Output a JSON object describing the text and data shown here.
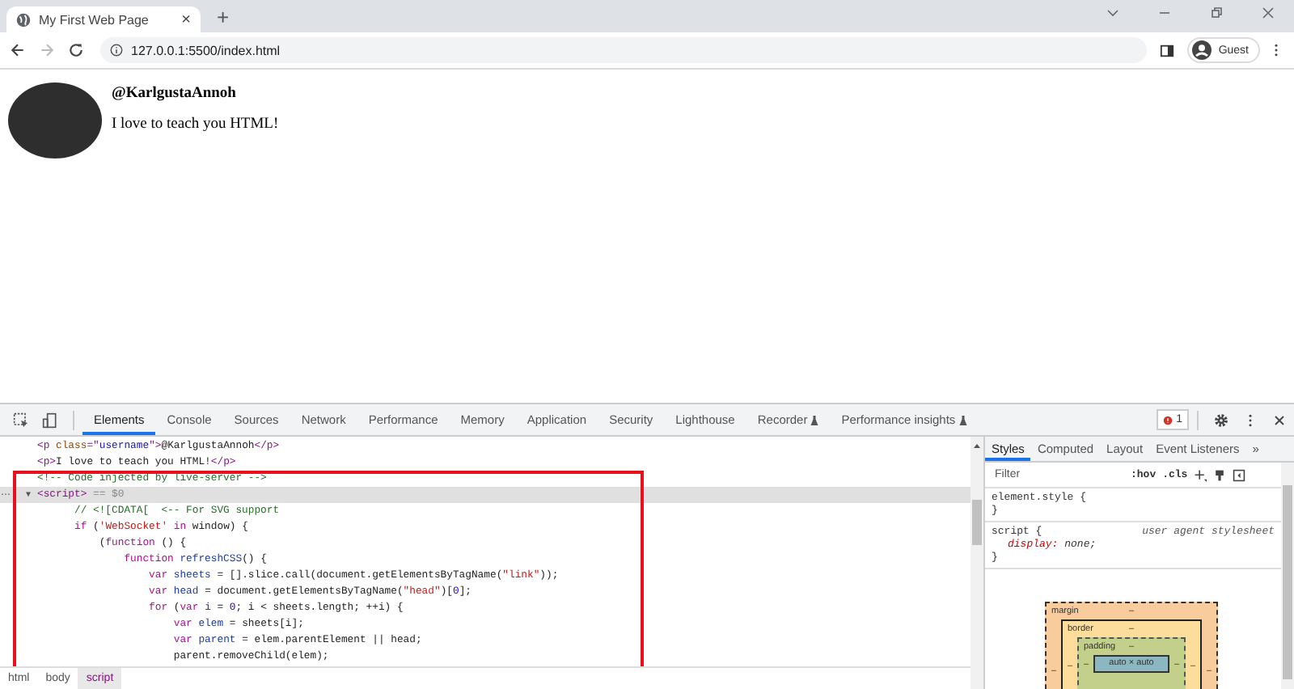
{
  "browser": {
    "tab": {
      "title": "My First Web Page",
      "close": "×"
    },
    "new_tab": "+",
    "address": "127.0.0.1:5500/index.html",
    "profile": "Guest"
  },
  "page": {
    "username": "@KarlgustaAnnoh",
    "text": "I love to teach you HTML!"
  },
  "devtools": {
    "tabs": [
      {
        "label": "Elements",
        "selected": true,
        "experimental": false
      },
      {
        "label": "Console",
        "selected": false,
        "experimental": false
      },
      {
        "label": "Sources",
        "selected": false,
        "experimental": false
      },
      {
        "label": "Network",
        "selected": false,
        "experimental": false
      },
      {
        "label": "Performance",
        "selected": false,
        "experimental": false
      },
      {
        "label": "Memory",
        "selected": false,
        "experimental": false
      },
      {
        "label": "Application",
        "selected": false,
        "experimental": false
      },
      {
        "label": "Security",
        "selected": false,
        "experimental": false
      },
      {
        "label": "Lighthouse",
        "selected": false,
        "experimental": false
      },
      {
        "label": "Recorder",
        "selected": false,
        "experimental": true
      },
      {
        "label": "Performance insights",
        "selected": false,
        "experimental": true
      }
    ],
    "error_count": "1",
    "code": [
      {
        "selected": false,
        "tokens": [
          {
            "text": "<p ",
            "kind": "tag"
          },
          {
            "text": "class",
            "kind": "attr"
          },
          {
            "text": "=\"",
            "kind": "tag"
          },
          {
            "text": "username",
            "kind": "value"
          },
          {
            "text": "\">",
            "kind": "tag"
          },
          {
            "text": "@KarlgustaAnnoh",
            "kind": "plain"
          },
          {
            "text": "</p>",
            "kind": "tag"
          }
        ]
      },
      {
        "selected": false,
        "tokens": [
          {
            "text": "<p>",
            "kind": "tag"
          },
          {
            "text": "I love to teach you HTML!",
            "kind": "plain"
          },
          {
            "text": "</p>",
            "kind": "tag"
          }
        ]
      },
      {
        "selected": false,
        "tokens": [
          {
            "text": "<!-- Code injected by live-server -->",
            "kind": "comment"
          }
        ]
      },
      {
        "selected": true,
        "gutter": "···",
        "toggle": "▼",
        "tokens": [
          {
            "text": "<script>",
            "kind": "tag"
          },
          {
            "text": " == $0",
            "kind": "dim"
          }
        ]
      },
      {
        "selected": false,
        "tokens": [
          {
            "text": "      // <![CDATA[  <-- For SVG support",
            "kind": "comment"
          }
        ]
      },
      {
        "selected": false,
        "tokens": [
          {
            "text": "      if",
            "kind": "keyword"
          },
          {
            "text": " (",
            "kind": "plain"
          },
          {
            "text": "'WebSocket'",
            "kind": "string"
          },
          {
            "text": " in ",
            "kind": "keyword"
          },
          {
            "text": "window) {",
            "kind": "plain"
          }
        ]
      },
      {
        "selected": false,
        "tokens": [
          {
            "text": "          (",
            "kind": "plain"
          },
          {
            "text": "function",
            "kind": "keyword"
          },
          {
            "text": " () {",
            "kind": "plain"
          }
        ]
      },
      {
        "selected": false,
        "tokens": [
          {
            "text": "              function",
            "kind": "keyword"
          },
          {
            "text": " refreshCSS",
            "kind": "name"
          },
          {
            "text": "() {",
            "kind": "plain"
          }
        ]
      },
      {
        "selected": false,
        "tokens": [
          {
            "text": "                  var",
            "kind": "keyword"
          },
          {
            "text": " sheets",
            "kind": "name"
          },
          {
            "text": " = [].slice.call(document.getElementsByTagName(",
            "kind": "plain"
          },
          {
            "text": "\"link\"",
            "kind": "string"
          },
          {
            "text": "));",
            "kind": "plain"
          }
        ]
      },
      {
        "selected": false,
        "tokens": [
          {
            "text": "                  var",
            "kind": "keyword"
          },
          {
            "text": " head",
            "kind": "name"
          },
          {
            "text": " = document.getElementsByTagName(",
            "kind": "plain"
          },
          {
            "text": "\"head\"",
            "kind": "string"
          },
          {
            "text": ")[",
            "kind": "plain"
          },
          {
            "text": "0",
            "kind": "number"
          },
          {
            "text": "];",
            "kind": "plain"
          }
        ]
      },
      {
        "selected": false,
        "tokens": [
          {
            "text": "                  for",
            "kind": "keyword"
          },
          {
            "text": " (",
            "kind": "plain"
          },
          {
            "text": "var",
            "kind": "keyword"
          },
          {
            "text": " i",
            "kind": "name"
          },
          {
            "text": " = ",
            "kind": "plain"
          },
          {
            "text": "0",
            "kind": "number"
          },
          {
            "text": "; i < sheets.length; ++i) {",
            "kind": "plain"
          }
        ]
      },
      {
        "selected": false,
        "tokens": [
          {
            "text": "                      var",
            "kind": "keyword"
          },
          {
            "text": " elem",
            "kind": "name"
          },
          {
            "text": " = sheets[i];",
            "kind": "plain"
          }
        ]
      },
      {
        "selected": false,
        "tokens": [
          {
            "text": "                      var",
            "kind": "keyword"
          },
          {
            "text": " parent",
            "kind": "name"
          },
          {
            "text": " = elem.parentElement || head;",
            "kind": "plain"
          }
        ]
      },
      {
        "selected": false,
        "tokens": [
          {
            "text": "                      parent.removeChild(elem);",
            "kind": "plain"
          }
        ]
      }
    ],
    "breadcrumbs": [
      {
        "label": "html",
        "selected": false
      },
      {
        "label": "body",
        "selected": false
      },
      {
        "label": "script",
        "selected": true
      }
    ],
    "side_tabs": [
      {
        "label": "Styles",
        "selected": true
      },
      {
        "label": "Computed",
        "selected": false
      },
      {
        "label": "Layout",
        "selected": false
      },
      {
        "label": "Event Listeners",
        "selected": false
      }
    ],
    "side_more": "»",
    "filter": {
      "placeholder": "Filter"
    },
    "filter_buttons": [
      ":hov",
      ".cls"
    ],
    "rules": [
      {
        "selector": "element.style {",
        "close": "}"
      },
      {
        "selector": "script {",
        "source": "user agent stylesheet",
        "declarations": [
          {
            "property": "display:",
            "value": "none;"
          }
        ],
        "close": "}"
      }
    ],
    "box_model": {
      "margin_label": "margin",
      "margin": "–",
      "border_label": "border",
      "border": "–",
      "padding_label": "padding",
      "padding": "–",
      "left_margin": "–",
      "left_border": "–",
      "left_padding": "–",
      "right_padding": "–",
      "right_border": "–",
      "right_margin": "–",
      "content": "auto × auto"
    }
  }
}
